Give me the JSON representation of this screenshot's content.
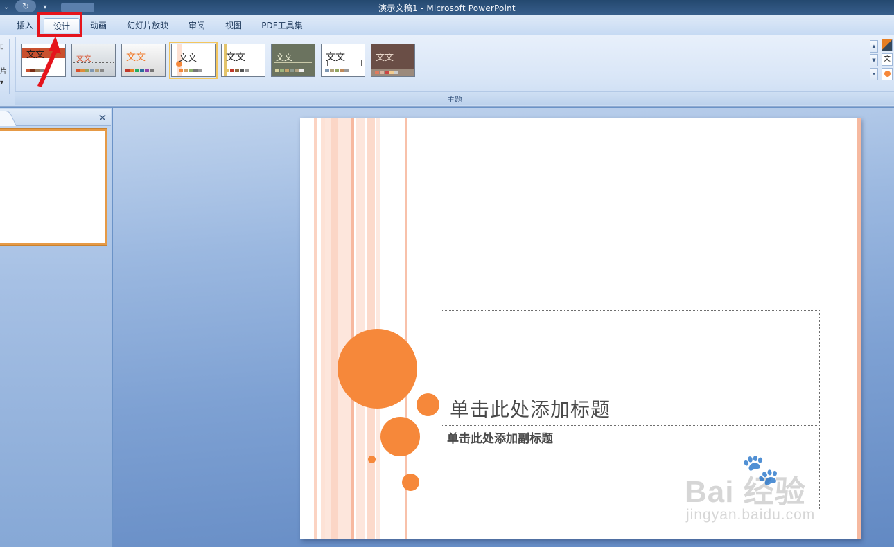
{
  "window": {
    "title": "演示文稿1 - Microsoft PowerPoint"
  },
  "ribbon": {
    "tabs": [
      {
        "label": "插入"
      },
      {
        "label": "设计"
      },
      {
        "label": "动画"
      },
      {
        "label": "幻灯片放映"
      },
      {
        "label": "审阅"
      },
      {
        "label": "视图"
      },
      {
        "label": "PDF工具集"
      }
    ],
    "active_tab": "设计",
    "left_stub_label": "片",
    "group_label": "主题",
    "themes": [
      {
        "sample": "文文",
        "text_color": "#ffffff",
        "bg": "#ffffff"
      },
      {
        "sample": "文文",
        "text_color": "#d9502c",
        "bg": "#dfe3e6"
      },
      {
        "sample": "文文",
        "text_color": "#f07a2a",
        "bg": "#f1f1f1"
      },
      {
        "sample": "文文",
        "text_color": "#333333",
        "bg": "#ffffff"
      },
      {
        "sample": "文文",
        "text_color": "#222222",
        "bg": "#ffffff"
      },
      {
        "sample": "文文",
        "text_color": "#f2f2d8",
        "bg": "#6b735f"
      },
      {
        "sample": "文文",
        "text_color": "#222222",
        "bg": "#ffffff"
      },
      {
        "sample": "文文",
        "text_color": "#e7d6c9",
        "bg": "#6a4e46"
      }
    ],
    "selected_theme_index": 3,
    "side_tools": [
      "颜色",
      "文",
      "效果"
    ]
  },
  "slides_panel": {
    "close_symbol": "×"
  },
  "slide": {
    "title_placeholder": "单击此处添加标题",
    "subtitle_placeholder": "单击此处添加副标题",
    "accent_color": "#f6883a"
  },
  "watermark": {
    "logo": "Bai  经验",
    "url": "jingyan.baidu.com"
  },
  "annotation": {
    "color": "#e5141c"
  }
}
